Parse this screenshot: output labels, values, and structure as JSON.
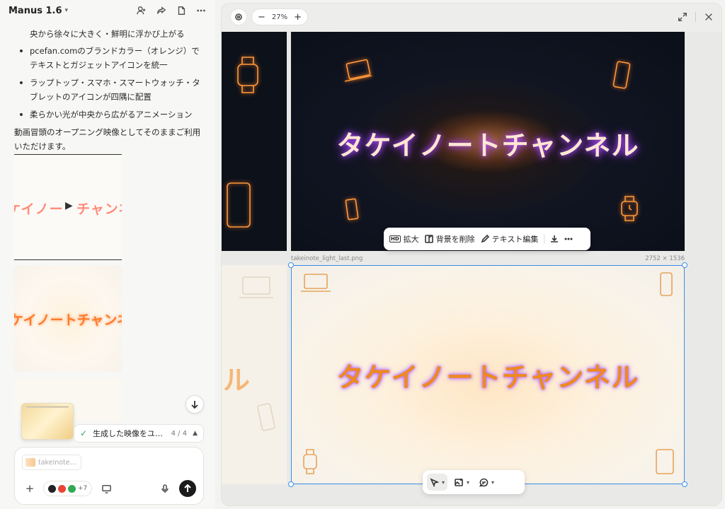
{
  "app": {
    "title": "Manus 1.6"
  },
  "chat": {
    "first_line": "央から徐々に大きく・鮮明に浮かび上がる",
    "bullets": [
      "pcefan.comのブランドカラー（オレンジ）でテキストとガジェットアイコンを統一",
      "ラップトップ・スマホ・スマートウォッチ・タブレットのアイコンが四隅に配置",
      "柔らかい光が中央から広がるアニメーション"
    ],
    "closing": "動画冒頭のオープニング映像としてそのままご利用いただけます。"
  },
  "thumbs": {
    "video_text_left": "ケイノー",
    "video_text_right": "チャンネ",
    "light_text": "ケイノートチャンネ"
  },
  "task": {
    "label": "生成した映像をユ…",
    "count": "4 / 4"
  },
  "composer": {
    "attachment": "takeinote…",
    "connector_more": "+7"
  },
  "viewer": {
    "zoom": "27%",
    "dark_title": "タケイノートチャンネル",
    "light_title": "タケイノートチャンネル",
    "side_title": "ル",
    "filename": "takeinote_light_last.png",
    "dimensions": "2752 × 1536",
    "toolbar": {
      "upscale": "拡大",
      "remove_bg": "背景を削除",
      "edit_text": "テキスト編集"
    }
  },
  "colors": {
    "brand_orange": "#ef8a1f",
    "selection": "#3a8ee6",
    "send": "#1b1b1b"
  }
}
